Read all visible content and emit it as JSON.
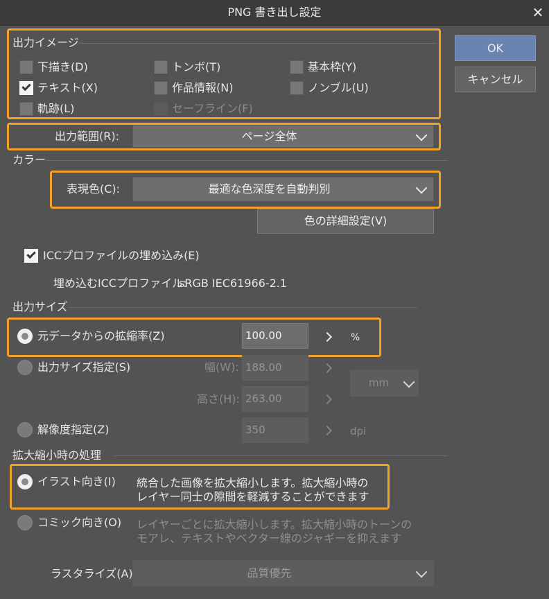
{
  "window": {
    "title": "PNG 書き出し設定",
    "close_glyph": "✕"
  },
  "buttons": {
    "ok": "OK",
    "cancel": "キャンセル"
  },
  "output_image": {
    "header": "出力イメージ",
    "items": [
      {
        "label": "下描き(D)",
        "checked": false,
        "enabled": true
      },
      {
        "label": "トンボ(T)",
        "checked": false,
        "enabled": true
      },
      {
        "label": "基本枠(Y)",
        "checked": false,
        "enabled": true
      },
      {
        "label": "テキスト(X)",
        "checked": true,
        "enabled": true
      },
      {
        "label": "作品情報(N)",
        "checked": false,
        "enabled": true
      },
      {
        "label": "ノンブル(U)",
        "checked": false,
        "enabled": true
      },
      {
        "label": "軌跡(L)",
        "checked": false,
        "enabled": true
      },
      {
        "label": "セーフライン(F)",
        "checked": false,
        "enabled": false
      }
    ]
  },
  "output_range": {
    "label": "出力範囲(R):",
    "value": "ページ全体"
  },
  "color": {
    "header": "カラー",
    "expression_label": "表現色(C):",
    "expression_value": "最適な色深度を自動判別",
    "detail_button": "色の詳細設定(V)",
    "icc_embed_label": "ICCプロファイルの埋め込み(E)",
    "icc_embed_checked": true,
    "icc_profile_label": "埋め込むICCプロファイル:",
    "icc_profile_value": "sRGB IEC61966-2.1"
  },
  "output_size": {
    "header": "出力サイズ",
    "scale_option": "元データからの拡縮率(Z)",
    "scale_value": "100.00",
    "scale_unit": "%",
    "size_option": "出力サイズ指定(S)",
    "width_label": "幅(W):",
    "width_value": "188.00",
    "height_label": "高さ(H):",
    "height_value": "263.00",
    "unit_select": "mm",
    "resolution_option": "解像度指定(Z)",
    "resolution_value": "350",
    "resolution_unit": "dpi",
    "selected": "scale"
  },
  "scaling": {
    "header": "拡大縮小時の処理",
    "illustration_option": "イラスト向き(I)",
    "illustration_desc_1": "統合した画像を拡大縮小します。拡大縮小時の",
    "illustration_desc_2": "レイヤー同士の隙間を軽減することができます",
    "comic_option": "コミック向き(O)",
    "comic_desc_1": "レイヤーごとに拡大縮小します。拡大縮小時のトーンの",
    "comic_desc_2": "モアレ、テキストやベクター線のジャギーを抑えます",
    "rasterize_label": "ラスタライズ(A):",
    "rasterize_value": "品質優先",
    "selected": "illustration"
  },
  "highlight_color": "#f4a12a",
  "accent_color": "#6a84b1"
}
